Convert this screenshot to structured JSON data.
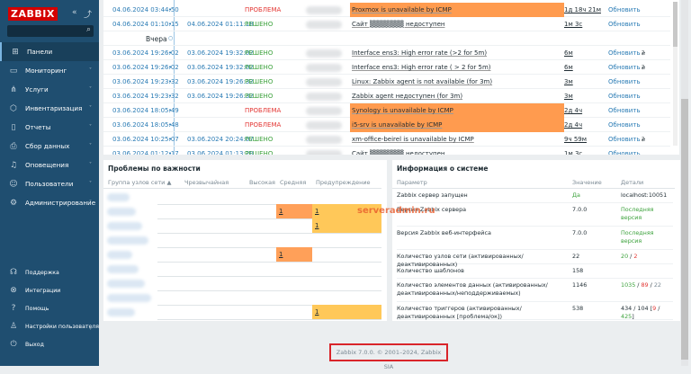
{
  "sidebar": {
    "logo": "ZABBIX",
    "items": [
      {
        "label": "Панели",
        "icon": "dashboard-icon",
        "glyph": "⊞"
      },
      {
        "label": "Мониторинг",
        "icon": "monitor-icon",
        "glyph": "▭"
      },
      {
        "label": "Услуги",
        "icon": "services-icon",
        "glyph": "⋔"
      },
      {
        "label": "Инвентаризация",
        "icon": "box-icon",
        "glyph": "⬡"
      },
      {
        "label": "Отчеты",
        "icon": "report-icon",
        "glyph": "▯"
      },
      {
        "label": "Сбор данных",
        "icon": "data-collection-icon",
        "glyph": "⎙"
      },
      {
        "label": "Оповещения",
        "icon": "bell-icon",
        "glyph": "♫"
      },
      {
        "label": "Пользователи",
        "icon": "users-icon",
        "glyph": "☺"
      },
      {
        "label": "Администрирование",
        "icon": "gear-icon",
        "glyph": "⚙"
      }
    ],
    "bottom": [
      {
        "label": "Поддержка",
        "icon": "headset-icon",
        "glyph": "☊"
      },
      {
        "label": "Интеграции",
        "icon": "integrations-icon",
        "glyph": "⊗"
      },
      {
        "label": "Помощь",
        "icon": "help-icon",
        "glyph": "?"
      },
      {
        "label": "Настройки пользователя",
        "icon": "user-settings-icon",
        "glyph": "♙"
      },
      {
        "label": "Выход",
        "icon": "power-icon",
        "glyph": "⏻"
      }
    ]
  },
  "problems": {
    "yesterday_label": "Вчера",
    "rows": [
      {
        "time": "04.06.2024 03:44:50",
        "recovery": "",
        "status": "ПРОБЛЕМА",
        "problem": "Proxmox is unavailable by ICMP",
        "duration": "1д 18ч 21м",
        "action": "Обновить",
        "highlight": true,
        "ext": ""
      },
      {
        "time": "04.06.2024 01:10:15",
        "recovery": "04.06.2024 01:11:18",
        "status": "РЕШЕНО",
        "problem": "Сайт ▒▒▒▒▒▒▒ недоступен",
        "duration": "1м 3с",
        "action": "Обновить",
        "highlight": false,
        "ext": ""
      },
      {
        "time": "03.06.2024 19:26:02",
        "recovery": "03.06.2024 19:32:02",
        "status": "РЕШЕНО",
        "problem": "Interface ens3: High error rate (>2 for 5m)",
        "duration": "6м",
        "action": "Обновить",
        "highlight": false,
        "ext": "2"
      },
      {
        "time": "03.06.2024 19:26:02",
        "recovery": "03.06.2024 19:32:02",
        "status": "РЕШЕНО",
        "problem": "Interface ens3: High error rate ( > 2 for 5m)",
        "duration": "6м",
        "action": "Обновить",
        "highlight": false,
        "ext": "2"
      },
      {
        "time": "03.06.2024 19:23:32",
        "recovery": "03.06.2024 19:26:32",
        "status": "РЕШЕНО",
        "problem": "Linux: Zabbix agent is not available (for 3m)",
        "duration": "3м",
        "action": "Обновить",
        "highlight": false,
        "ext": ""
      },
      {
        "time": "03.06.2024 19:23:32",
        "recovery": "03.06.2024 19:26:32",
        "status": "РЕШЕНО",
        "problem": "Zabbix agent недоступен (for 3m)",
        "duration": "3м",
        "action": "Обновить",
        "highlight": false,
        "ext": ""
      },
      {
        "time": "03.06.2024 18:05:49",
        "recovery": "",
        "status": "ПРОБЛЕМА",
        "problem": "Synology is unavailable by ICMP",
        "duration": "2д 4ч",
        "action": "Обновить",
        "highlight": true,
        "ext": ""
      },
      {
        "time": "03.06.2024 18:05:48",
        "recovery": "",
        "status": "ПРОБЛЕМА",
        "problem": "i5-srv is unavailable by ICMP",
        "duration": "2д 4ч",
        "action": "Обновить",
        "highlight": true,
        "ext": ""
      },
      {
        "time": "03.06.2024 10:25:07",
        "recovery": "03.06.2024 20:24:07",
        "status": "РЕШЕНО",
        "problem": "xm-office-beirel is unavailable by ICMP",
        "duration": "9ч 59м",
        "action": "Обновить",
        "highlight": false,
        "ext": "2"
      },
      {
        "time": "03.06.2024 01:12:17",
        "recovery": "03.06.2024 01:13:20",
        "status": "РЕШЕНО",
        "problem": "Сайт ▒▒▒▒▒▒▒ недоступен",
        "duration": "1м 3с",
        "action": "Обновить",
        "highlight": false,
        "ext": ""
      }
    ]
  },
  "severity": {
    "title": "Проблемы по важности",
    "headers": [
      "Группа узлов сети ▲",
      "Чрезвычайная",
      "Высокая",
      "Средняя",
      "Предупреждение"
    ],
    "rows": [
      {
        "avg": "",
        "warn": ""
      },
      {
        "avg": "1",
        "warn": "1"
      },
      {
        "avg": "",
        "warn": "1"
      },
      {
        "avg": "",
        "warn": ""
      },
      {
        "avg": "1",
        "warn": ""
      },
      {
        "avg": "",
        "warn": ""
      },
      {
        "avg": "",
        "warn": ""
      },
      {
        "avg": "",
        "warn": ""
      },
      {
        "avg": "",
        "warn": "1"
      }
    ]
  },
  "sysinfo": {
    "title": "Информация о системе",
    "headers": [
      "Параметр",
      "Значение",
      "Детали"
    ],
    "rows": [
      {
        "param": "Zabbix сервер запущен",
        "value": "Да",
        "details": "localhost:10051"
      },
      {
        "param": "Версия Zabbix сервера",
        "value": "7.0.0",
        "details": "Последняя версия"
      },
      {
        "param": "Версия Zabbix веб-интерфейса",
        "value": "7.0.0",
        "details": "Последняя версия"
      },
      {
        "param": "Количество узлов сети (активированных/деактивированных)",
        "value": "22",
        "details": "",
        "d1": "20",
        "d2": "2"
      },
      {
        "param": "Количество шаблонов",
        "value": "158",
        "details": ""
      },
      {
        "param": "Количество элементов данных (активированных/деактивированных/неподдерживаемых)",
        "value": "1146",
        "details": "",
        "d1": "1035",
        "d2": "89",
        "d3": "22"
      },
      {
        "param": "Количество триггеров (активированных/деактивированных [проблема/ок])",
        "value": "538",
        "details": "",
        "t1": "434 / 104 [",
        "t2": "9",
        "t3": "425",
        "t4": "]"
      }
    ]
  },
  "footer": "Zabbix 7.0.0. © 2001–2024, Zabbix SIA",
  "watermark": "serveradmin.ru",
  "colors": {
    "sidebar": "#1f4e70",
    "problem_highlight": "#ff9b4f",
    "average": "#ffa059",
    "warning": "#ffc859",
    "ok": "#3ca23c",
    "problem": "#e33734"
  }
}
